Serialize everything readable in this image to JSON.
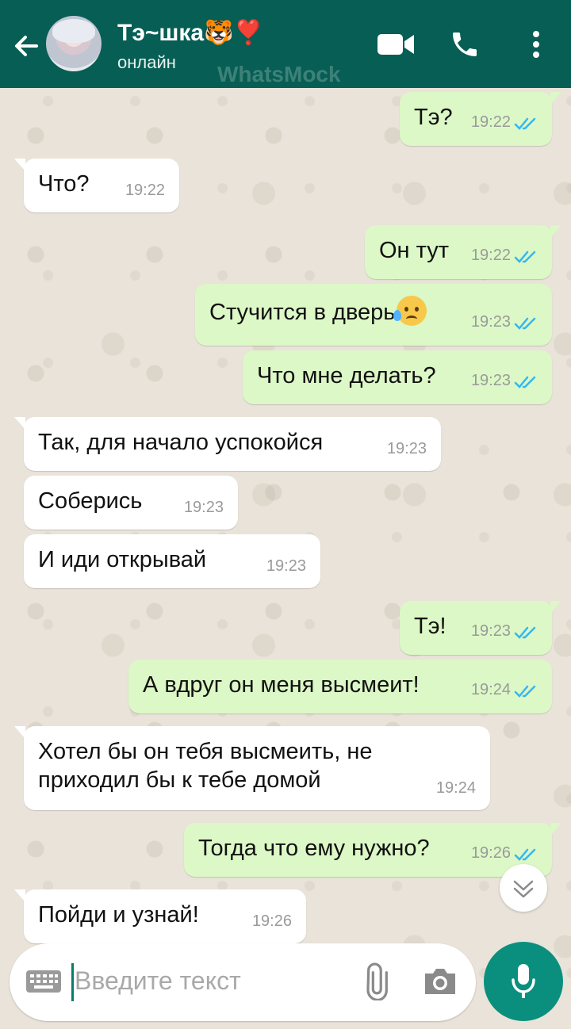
{
  "header": {
    "contact_name": "Тэ~шка🐯❣️",
    "status": "онлайн",
    "watermark": "WhatsMock",
    "icons": [
      "back-arrow-icon",
      "video-call-icon",
      "phone-icon",
      "more-vert-icon"
    ],
    "color": "#075e54"
  },
  "messages": [
    {
      "dir": "out",
      "text": "Тэ?",
      "time": "19:22",
      "read": true
    },
    {
      "dir": "in",
      "text": "Что?",
      "time": "19:22"
    },
    {
      "dir": "out",
      "text": "Он тут",
      "time": "19:22",
      "read": true
    },
    {
      "dir": "out",
      "text": "Стучится в дверь",
      "emoji": "disappointed-relieved-face",
      "time": "19:23",
      "read": true
    },
    {
      "dir": "out",
      "text": "Что мне делать?",
      "time": "19:23",
      "read": true
    },
    {
      "dir": "in",
      "text": "Так, для начало успокойся",
      "time": "19:23"
    },
    {
      "dir": "in",
      "text": "Соберись",
      "time": "19:23"
    },
    {
      "dir": "in",
      "text": "И иди открывай",
      "time": "19:23"
    },
    {
      "dir": "out",
      "text": "Тэ!",
      "time": "19:23",
      "read": true
    },
    {
      "dir": "out",
      "text": "А вдруг он меня высмеит!",
      "time": "19:24",
      "read": true
    },
    {
      "dir": "in",
      "text_line1": "Хотел бы он тебя высмеить, не",
      "text_line2": "приходил бы к тебе домой",
      "time": "19:24"
    },
    {
      "dir": "out",
      "text": "Тогда что ему нужно?",
      "time": "19:26",
      "read": true
    },
    {
      "dir": "in",
      "text": "Пойди и узнай!",
      "time": "19:26"
    }
  ],
  "composer": {
    "placeholder": "Введите текст",
    "icons": [
      "keyboard-icon",
      "attach-icon",
      "camera-icon",
      "mic-icon"
    ]
  },
  "colors": {
    "outgoing_bubble": "#dcf8c6",
    "incoming_bubble": "#ffffff",
    "read_ticks": "#34b7f1",
    "accent": "#0a8f7e"
  }
}
